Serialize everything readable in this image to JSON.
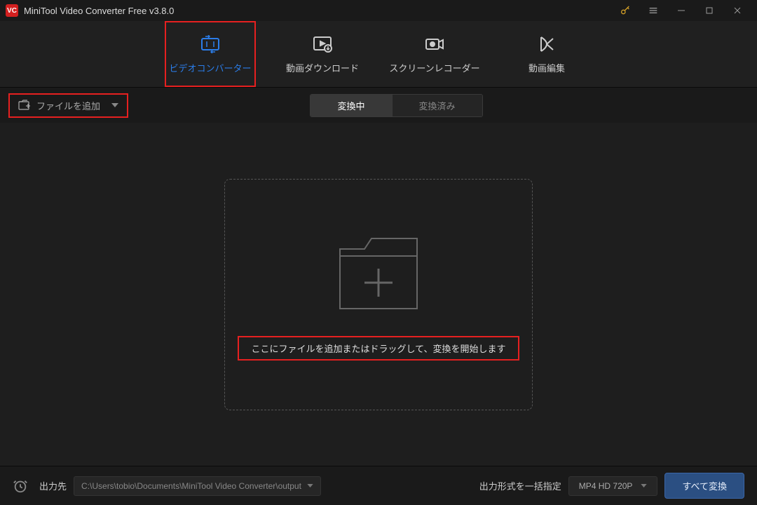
{
  "titlebar": {
    "title": "MiniTool Video Converter Free v3.8.0"
  },
  "topnav": {
    "converter": "ビデオコンバーター",
    "download": "動画ダウンロード",
    "recorder": "スクリーンレコーダー",
    "editor": "動画編集"
  },
  "toolbar": {
    "add_file": "ファイルを追加"
  },
  "subtabs": {
    "converting": "変換中",
    "converted": "変換済み"
  },
  "dropzone": {
    "text": "ここにファイルを追加またはドラッグして、変換を開始します"
  },
  "footer": {
    "output_label": "出力先",
    "output_path": "C:\\Users\\tobio\\Documents\\MiniTool Video Converter\\output",
    "format_label": "出力形式を一括指定",
    "format_value": "MP4 HD 720P",
    "convert_all": "すべて変換"
  }
}
